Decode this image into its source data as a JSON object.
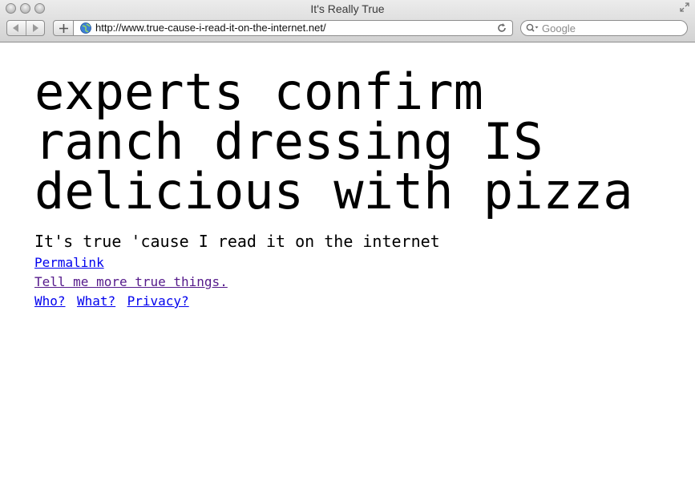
{
  "window": {
    "title": "It's Really True"
  },
  "toolbar": {
    "url": "http://www.true-cause-i-read-it-on-the-internet.net/",
    "search_placeholder": "Google"
  },
  "page": {
    "headline": [
      "experts confirm",
      "ranch dressing IS",
      "delicious with pizza"
    ],
    "subtitle": "It's true 'cause I read it on the internet",
    "permalink": "Permalink",
    "more_link": "Tell me more true things.",
    "footer_links": [
      "Who?",
      "What?",
      "Privacy?"
    ]
  },
  "colors": {
    "link": "#0000ee",
    "visited_link": "#551a8b"
  }
}
